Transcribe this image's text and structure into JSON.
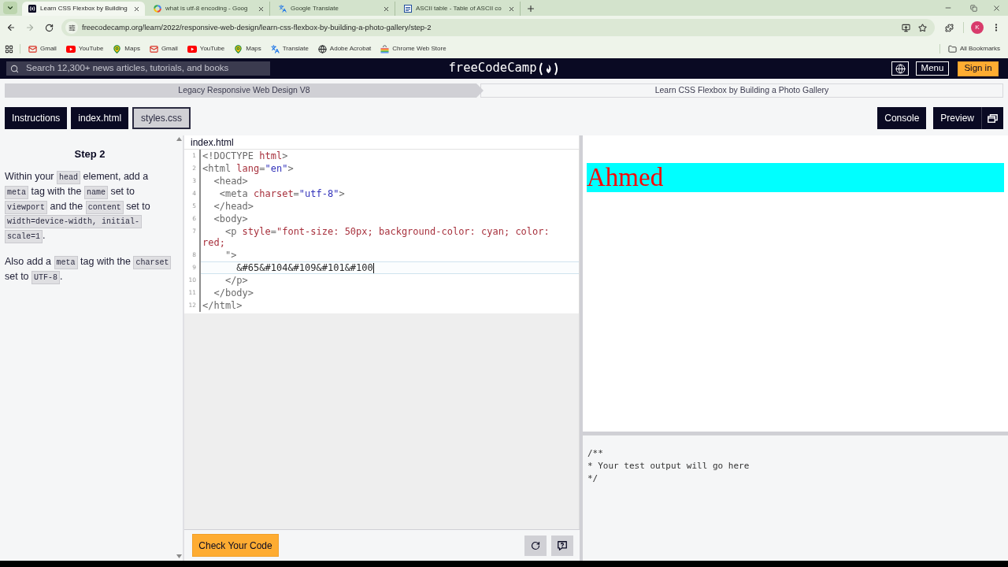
{
  "browser": {
    "tabs": [
      {
        "kind": "coding",
        "title": "Learn CSS Flexbox by Building",
        "selected": true
      },
      {
        "kind": "search",
        "title": "what is utf-8 encoding - Goog",
        "selected": false
      },
      {
        "kind": "translate",
        "title": "Google Translate",
        "selected": false
      },
      {
        "kind": "reference",
        "title": "ASCII table - Table of ASCII co",
        "selected": false
      }
    ],
    "url": "freecodecamp.org/learn/2022/responsive-web-design/learn-css-flexbox-by-building-a-photo-gallery/step-2",
    "profile_initial": "K",
    "bookmarks": [
      {
        "kind": "mail",
        "label": "Gmail"
      },
      {
        "kind": "video",
        "label": "YouTube"
      },
      {
        "kind": "map",
        "label": "Maps"
      },
      {
        "kind": "mail",
        "label": "Gmail"
      },
      {
        "kind": "video",
        "label": "YouTube"
      },
      {
        "kind": "map",
        "label": "Maps"
      },
      {
        "kind": "translate",
        "label": "Translate"
      },
      {
        "kind": "web",
        "label": "Adobe Acrobat"
      },
      {
        "kind": "store",
        "label": "Chrome Web Store"
      }
    ],
    "all_bookmarks": "All Bookmarks"
  },
  "navbar": {
    "search": {
      "placeholder": "Search 12,300+ news articles, tutorials, and books"
    },
    "logo": "freeCodeCamp",
    "menu": "Menu",
    "sign_in": "Sign in"
  },
  "breadcrumbs": [
    {
      "kind": "parent",
      "label": "Legacy Responsive Web Design V8"
    },
    {
      "kind": "current",
      "label": "Learn CSS Flexbox by Building a Photo Gallery"
    }
  ],
  "pane_tabs": [
    {
      "label": "Instructions",
      "selected": true
    },
    {
      "label": "index.html",
      "selected": true
    },
    {
      "label": "styles.css",
      "selected": false
    }
  ],
  "view_buttons": [
    {
      "label": "Console",
      "selected": true,
      "popout": false
    },
    {
      "label": "Preview",
      "selected": true,
      "popout": true
    }
  ],
  "instructions": {
    "title": "Step 2",
    "paragraphs": [
      [
        {
          "kind": "text",
          "text": "Within your "
        },
        {
          "kind": "code",
          "text": "head"
        },
        {
          "kind": "text",
          "text": " element, add a "
        },
        {
          "kind": "code",
          "text": "meta"
        },
        {
          "kind": "text",
          "text": " tag with the "
        },
        {
          "kind": "code",
          "text": "name"
        },
        {
          "kind": "text",
          "text": " set to "
        },
        {
          "kind": "code",
          "text": "viewport"
        },
        {
          "kind": "text",
          "text": " and the "
        },
        {
          "kind": "code",
          "text": "content"
        },
        {
          "kind": "text",
          "text": " set to "
        },
        {
          "kind": "code",
          "text": "width=device-width, initial-scale=1"
        },
        {
          "kind": "text",
          "text": "."
        }
      ],
      [
        {
          "kind": "text",
          "text": "Also add a "
        },
        {
          "kind": "code",
          "text": "meta"
        },
        {
          "kind": "text",
          "text": " tag with the "
        },
        {
          "kind": "code",
          "text": "charset"
        },
        {
          "kind": "text",
          "text": " set to "
        },
        {
          "kind": "code",
          "text": "UTF-8"
        },
        {
          "kind": "text",
          "text": "."
        }
      ]
    ]
  },
  "editor": {
    "file": "index.html",
    "lines": [
      {
        "number": "1",
        "current": false,
        "tokens": [
          {
            "kind": "tag",
            "text": "<!DOCTYPE "
          },
          {
            "kind": "name",
            "text": "html"
          },
          {
            "kind": "tag",
            "text": ">"
          }
        ]
      },
      {
        "number": "2",
        "current": false,
        "tokens": [
          {
            "kind": "tag",
            "text": "<html"
          },
          {
            "kind": "attr",
            "text": " lang"
          },
          {
            "kind": "tag",
            "text": "="
          },
          {
            "kind": "string",
            "text": "\"en\""
          },
          {
            "kind": "tag",
            "text": ">"
          }
        ]
      },
      {
        "number": "3",
        "current": false,
        "tokens": [
          {
            "kind": "tag",
            "text": "  <head>"
          }
        ]
      },
      {
        "number": "4",
        "current": false,
        "tokens": [
          {
            "kind": "tag",
            "text": "   <meta"
          },
          {
            "kind": "attr",
            "text": " charset"
          },
          {
            "kind": "tag",
            "text": "="
          },
          {
            "kind": "string",
            "text": "\"utf-8\""
          },
          {
            "kind": "tag",
            "text": ">"
          }
        ]
      },
      {
        "number": "5",
        "current": false,
        "tokens": [
          {
            "kind": "tag",
            "text": "  </head>"
          }
        ]
      },
      {
        "number": "6",
        "current": false,
        "tokens": [
          {
            "kind": "tag",
            "text": "  <body>"
          }
        ]
      },
      {
        "number": "7",
        "current": false,
        "tokens": [
          {
            "kind": "tag",
            "text": "    <p"
          },
          {
            "kind": "attr",
            "text": " style"
          },
          {
            "kind": "tag",
            "text": "="
          },
          {
            "kind": "style",
            "text": "\"font-size: 50px; background-color: cyan; color: red;"
          }
        ]
      },
      {
        "number": "8",
        "current": false,
        "tokens": [
          {
            "kind": "tag",
            "text": "    \">"
          }
        ]
      },
      {
        "number": "9",
        "current": true,
        "tokens": [
          {
            "kind": "text",
            "text": "      &#65&#104&#109&#101&#100"
          }
        ]
      },
      {
        "number": "10",
        "current": false,
        "tokens": [
          {
            "kind": "tag",
            "text": "    </p>"
          }
        ]
      },
      {
        "number": "11",
        "current": false,
        "tokens": [
          {
            "kind": "tag",
            "text": "  </body>"
          }
        ]
      },
      {
        "number": "12",
        "current": false,
        "tokens": [
          {
            "kind": "tag",
            "text": "</html>"
          }
        ]
      }
    ]
  },
  "actions": {
    "check": "Check Your Code"
  },
  "preview": {
    "text": "Ahmed"
  },
  "test_output": [
    "/**",
    "* Your test output will go here",
    "*/"
  ]
}
